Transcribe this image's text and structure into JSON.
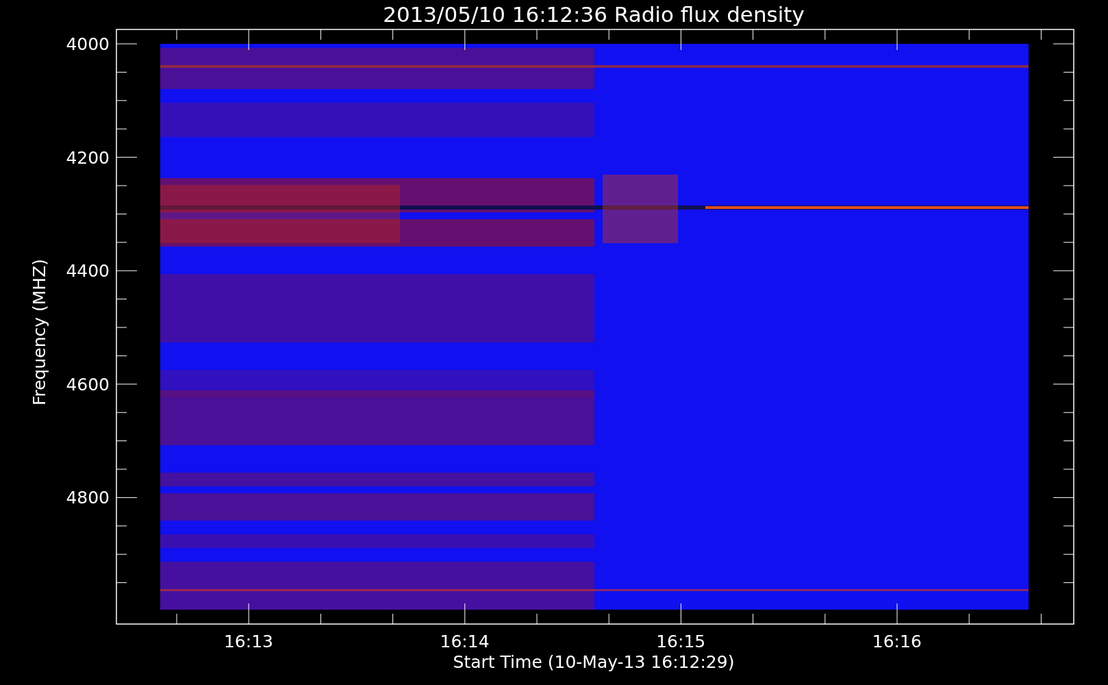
{
  "title": "2013/05/10 16:12:36 Radio flux density",
  "y_axis": {
    "label": "Frequency (MHZ)",
    "ticks": [
      "4000",
      "4200",
      "4400",
      "4600",
      "4800"
    ]
  },
  "x_axis": {
    "label": "Start Time (10-May-13 16:12:29)",
    "ticks": [
      "16:13",
      "16:14",
      "16:15",
      "16:16"
    ]
  }
}
